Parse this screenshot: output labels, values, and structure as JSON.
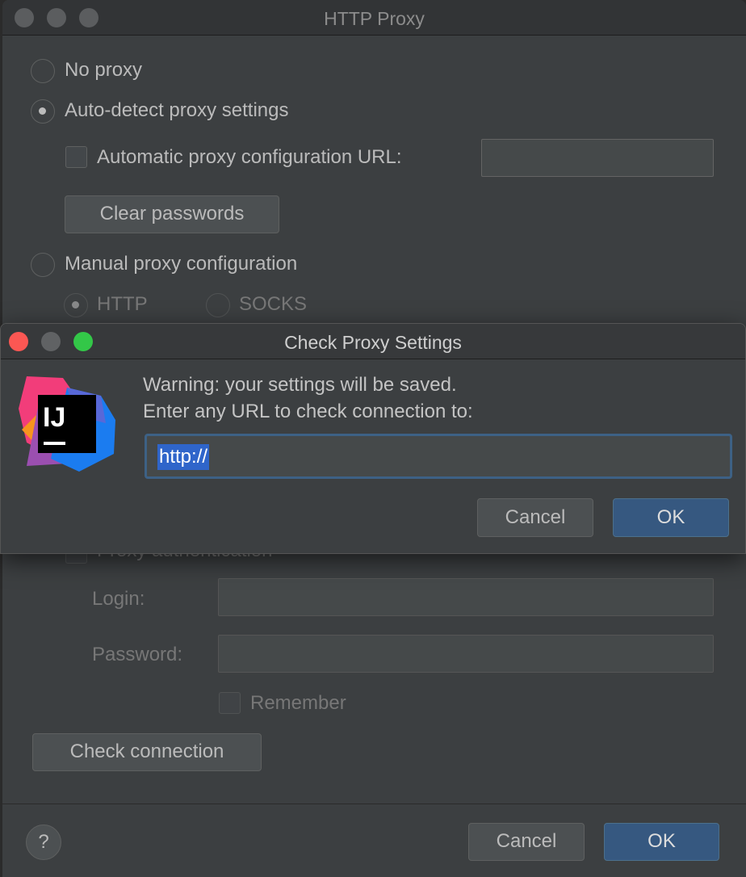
{
  "main_window": {
    "title": "HTTP Proxy",
    "no_proxy": "No proxy",
    "auto_detect": "Auto-detect proxy settings",
    "auto_config_url": "Automatic proxy configuration URL:",
    "auto_config_url_value": "",
    "clear_passwords": "Clear passwords",
    "manual": "Manual proxy configuration",
    "http": "HTTP",
    "socks": "SOCKS",
    "proxy_auth": "Proxy authentication",
    "login": "Login:",
    "password": "Password:",
    "remember": "Remember",
    "check_connection": "Check connection",
    "help": "?",
    "cancel": "Cancel",
    "ok": "OK",
    "selected_option": "Auto-detect proxy settings"
  },
  "modal": {
    "title": "Check Proxy Settings",
    "line1": "Warning: your settings will be saved.",
    "line2": "Enter any URL to check connection to:",
    "url_value": "http://",
    "cancel": "Cancel",
    "ok": "OK",
    "logo_text": "IJ"
  },
  "colors": {
    "accent": "#365880",
    "selection": "#2f65ca",
    "close": "#fc5753",
    "zoom": "#33c748"
  }
}
